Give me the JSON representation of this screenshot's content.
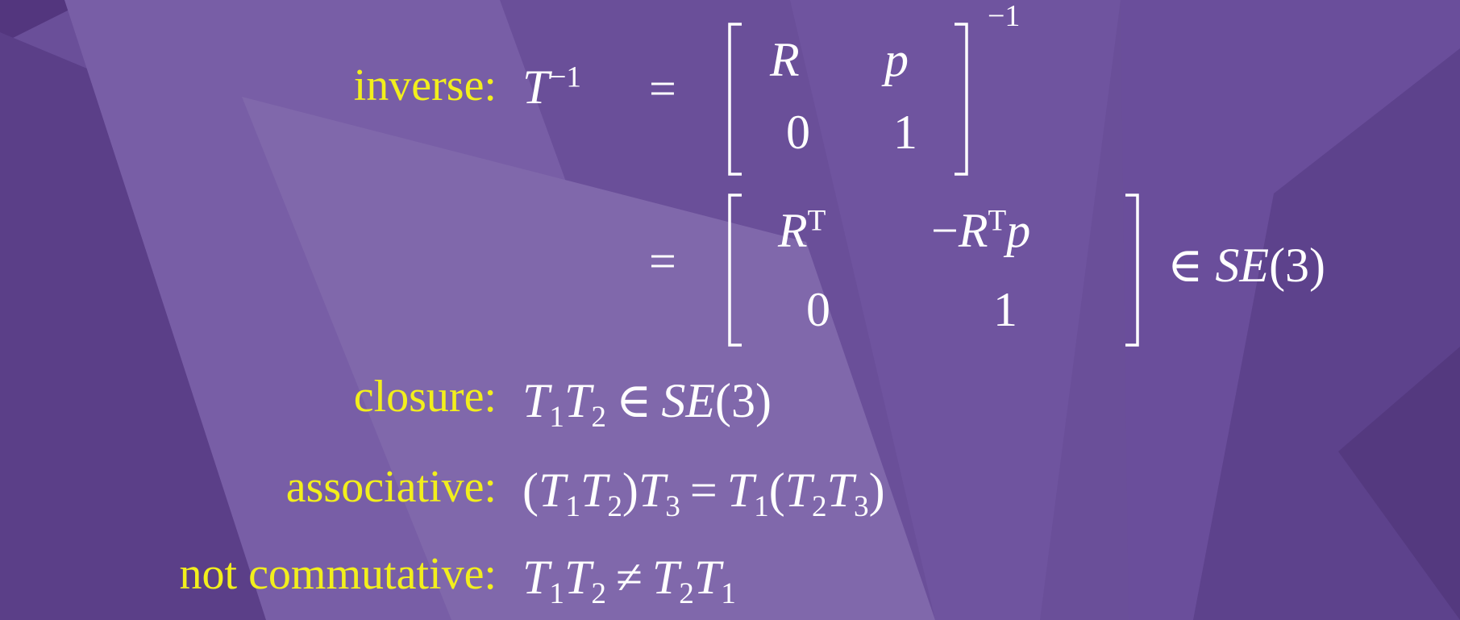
{
  "colors": {
    "label": "#f2ef1c",
    "math": "#ffffff",
    "background": "#6a4f99"
  },
  "inverse": {
    "label": "inverse:",
    "lhs_var": "T",
    "lhs_exp": "−1",
    "equals": "=",
    "m1": {
      "a": "R",
      "b": "p",
      "c": "0",
      "d": "1"
    },
    "m1_exp": "−1",
    "equals2": "=",
    "m2": {
      "a_var": "R",
      "a_sup": "T",
      "b_minus": "−",
      "b_var1": "R",
      "b_sup": "T",
      "b_var2": "p",
      "c": "0",
      "d": "1"
    },
    "in": "∈",
    "group": "SE",
    "group_arg": "(3)"
  },
  "closure": {
    "label": "closure:",
    "T": "T",
    "s1": "1",
    "s2": "2",
    "in": "∈",
    "group": "SE",
    "group_arg": "(3)"
  },
  "associative": {
    "label": "associative:",
    "lp": "(",
    "T": "T",
    "s1": "1",
    "s2": "2",
    "rp": ")",
    "s3": "3",
    "equals": "="
  },
  "commutative": {
    "label": "not commutative:",
    "T": "T",
    "s1": "1",
    "s2": "2",
    "neq": "≠"
  }
}
